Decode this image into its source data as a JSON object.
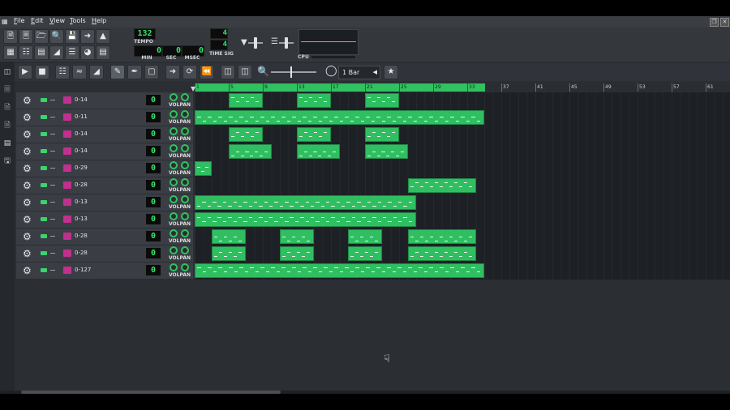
{
  "menu": {
    "items": [
      {
        "label": "File",
        "accel": "F",
        "rest": "ile"
      },
      {
        "label": "Edit",
        "accel": "E",
        "rest": "dit"
      },
      {
        "label": "View",
        "accel": "V",
        "rest": "iew"
      },
      {
        "label": "Tools",
        "accel": "T",
        "rest": "ools"
      },
      {
        "label": "Help",
        "accel": "H",
        "rest": "elp"
      }
    ]
  },
  "transport": {
    "tempo_value": "132",
    "tempo_label": "TEMPO",
    "min_value": "0",
    "min_label": "MIN",
    "sec_value": "0",
    "sec_label": "SEC",
    "msec_value": "0",
    "msec_label": "MSEC",
    "timesig_num": "4",
    "timesig_den": "4",
    "timesig_label": "TIME SIG",
    "cpu_label": "CPU"
  },
  "song_editor": {
    "zoom_label": "1 Bar",
    "ruler_ticks": [
      "1",
      "5",
      "9",
      "13",
      "17",
      "21",
      "25",
      "29",
      "33",
      "37",
      "41",
      "45",
      "49",
      "53",
      "57",
      "61"
    ]
  },
  "tracks": [
    {
      "name": "0-14",
      "value": "0"
    },
    {
      "name": "0-11",
      "value": "0"
    },
    {
      "name": "0-14",
      "value": "0"
    },
    {
      "name": "0-14",
      "value": "0"
    },
    {
      "name": "0-29",
      "value": "0"
    },
    {
      "name": "0-28",
      "value": "0"
    },
    {
      "name": "0-13",
      "value": "0"
    },
    {
      "name": "0-13",
      "value": "0"
    },
    {
      "name": "0-28",
      "value": "0"
    },
    {
      "name": "0-28",
      "value": "0"
    },
    {
      "name": "0-127",
      "value": "0"
    }
  ],
  "track_labels": {
    "vol": "VOL",
    "pan": "PAN"
  },
  "colors": {
    "accent": "#2fbf61",
    "lcd": "#34e26b",
    "instrument": "#c0308c"
  }
}
